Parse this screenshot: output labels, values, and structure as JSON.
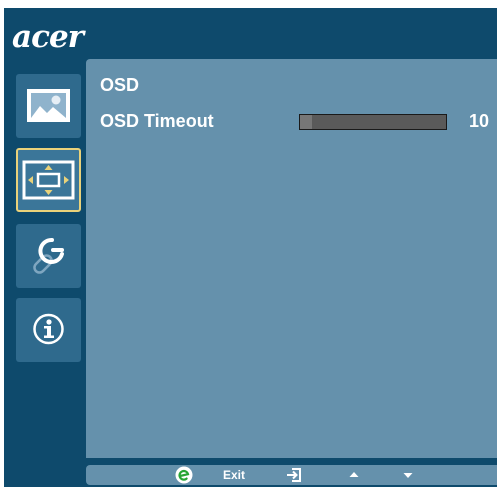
{
  "brand": {
    "logo_text": "acer"
  },
  "sidebar": {
    "items": [
      {
        "name": "picture",
        "icon": "picture-icon",
        "selected": false
      },
      {
        "name": "osd",
        "icon": "osd-position-icon",
        "selected": true
      },
      {
        "name": "settings",
        "icon": "wrench-icon",
        "selected": false
      },
      {
        "name": "information",
        "icon": "info-icon",
        "selected": false
      }
    ]
  },
  "main": {
    "section_title": "OSD",
    "settings": [
      {
        "label": "OSD Timeout",
        "value": "10",
        "level": 10,
        "level_max": 120
      }
    ]
  },
  "bottom_bar": {
    "items": [
      {
        "icon": "empowering-e-icon"
      },
      {
        "label": "Exit"
      },
      {
        "icon": "enter-icon"
      },
      {
        "icon": "arrow-up-icon"
      },
      {
        "icon": "arrow-down-icon"
      }
    ]
  },
  "colors": {
    "frame_bg": "#0e4a6c",
    "panel_bg": "#6591ac",
    "tile_bg": "#2f6a8d",
    "selection_border": "#e9d27a",
    "e_key_green": "#27a534"
  }
}
